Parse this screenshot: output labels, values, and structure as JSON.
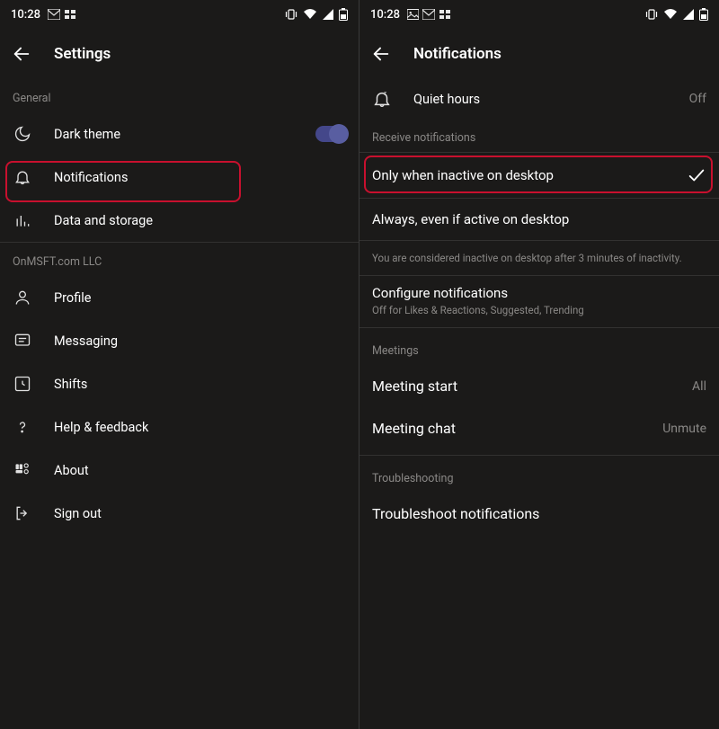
{
  "status": {
    "time": "10:28",
    "left_icons": [
      "image-icon",
      "mail-icon",
      "overflow-icon"
    ],
    "right_icons": [
      "vibrate-icon",
      "wifi-icon",
      "signal-icon",
      "battery-icon"
    ]
  },
  "left_phone": {
    "title": "Settings",
    "sections": [
      {
        "header": "General",
        "items": [
          {
            "icon": "moon-icon",
            "label": "Dark theme",
            "toggle": true
          },
          {
            "icon": "bell-icon",
            "label": "Notifications",
            "highlighted": true
          },
          {
            "icon": "chart-icon",
            "label": "Data and storage"
          }
        ]
      },
      {
        "header": "OnMSFT.com LLC",
        "items": [
          {
            "icon": "person-icon",
            "label": "Profile"
          },
          {
            "icon": "message-icon",
            "label": "Messaging"
          },
          {
            "icon": "clock-icon",
            "label": "Shifts"
          },
          {
            "icon": "help-icon",
            "label": "Help & feedback"
          },
          {
            "icon": "about-icon",
            "label": "About"
          },
          {
            "icon": "signout-icon",
            "label": "Sign out"
          }
        ]
      }
    ]
  },
  "right_phone": {
    "title": "Notifications",
    "quiet_hours": {
      "label": "Quiet hours",
      "value": "Off"
    },
    "receive_header": "Receive notifications",
    "receive_options": [
      {
        "label": "Only when inactive on desktop",
        "selected": true,
        "highlighted": true
      },
      {
        "label": "Always, even if active on desktop",
        "selected": false
      }
    ],
    "inactive_help": "You are considered inactive on desktop after 3 minutes of inactivity.",
    "configure": {
      "label": "Configure notifications",
      "sub": "Off for Likes & Reactions, Suggested, Trending"
    },
    "meetings_header": "Meetings",
    "meetings": [
      {
        "label": "Meeting start",
        "value": "All"
      },
      {
        "label": "Meeting chat",
        "value": "Unmute"
      }
    ],
    "troubleshooting_header": "Troubleshooting",
    "troubleshoot_label": "Troubleshoot notifications"
  },
  "colors": {
    "highlight": "#c8102e",
    "accent": "#7b83eb"
  }
}
